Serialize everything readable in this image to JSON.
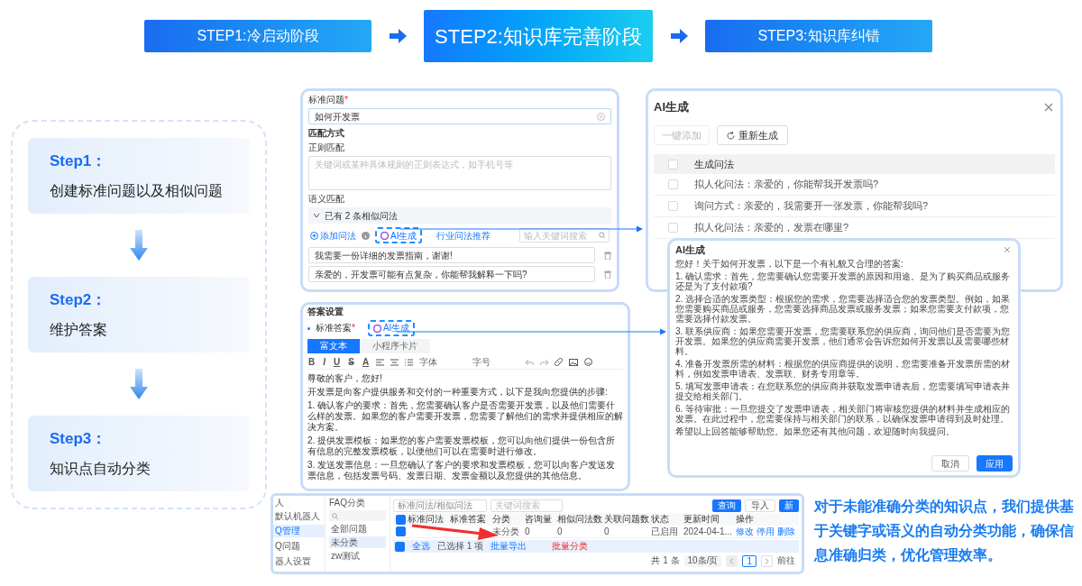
{
  "steps_banner": [
    {
      "label": "STEP1:冷启动阶段",
      "selected": false
    },
    {
      "label": "STEP2:知识库完善阶段",
      "selected": true
    },
    {
      "label": "STEP3:知识库纠错",
      "selected": false
    }
  ],
  "step_cards": [
    {
      "title": "Step1：",
      "text": "创建标准问题以及相似问题"
    },
    {
      "title": "Step2：",
      "text": "维护答案"
    },
    {
      "title": "Step3：",
      "text": "知识点自动分类"
    }
  ],
  "question_form": {
    "title_label": "标准问题",
    "required_mark": "*",
    "question_value": "如何开发票",
    "match_label": "匹配方式",
    "regex_label": "正则匹配",
    "regex_placeholder": "关键词或某种具体规则的正则表达式，如手机号等",
    "semantic_label": "语义匹配",
    "similar_header": "已有 2 条相似问法",
    "expanded": true,
    "add_link": "添加问法",
    "ai_button": "AI生成",
    "recommend_link": "行业问法推荐",
    "search_placeholder": "输入关键词搜索",
    "similar_questions": [
      "我需要一份详细的发票指南，谢谢!",
      "亲爱的，开发票可能有点复杂，你能帮我解释一下吗?"
    ]
  },
  "answer_form": {
    "title": "答案设置",
    "answer_label": "标准答案",
    "required_mark": "*",
    "ai_button": "AI生成",
    "tabs": [
      {
        "label": "富文本",
        "selected": true
      },
      {
        "label": "小程序卡片",
        "selected": false
      }
    ],
    "format_buttons": [
      "B",
      "I",
      "U",
      "S",
      "A"
    ],
    "font_select": "字体",
    "size_select": "字号",
    "paragraphs": [
      "尊敬的客户，您好!",
      "开发票是向客户提供服务和交付的一种重要方式，以下是我向您提供的步骤:",
      "1. 确认客户的要求：首先，您需要确认客户是否需要开发票，以及他们需要什么样的发票。如果您的客户需要开发票，您需要了解他们的需求并提供相应的解决方案。",
      "2. 提供发票模板：如果您的客户需要发票模板，您可以向他们提供一份包含所有信息的完整发票模板，以便他们可以在需要时进行修改。",
      "3. 发送发票信息：一旦您确认了客户的要求和发票模板，您可以向客户发送发票信息，包括发票号码、发票日期、发票金额以及您提供的其他信息。"
    ]
  },
  "ai_questions_dialog": {
    "title": "AI生成",
    "add_button": "一键添加",
    "regenerate_button": "重新生成",
    "column": "生成问法",
    "header_checked": false,
    "rows": [
      {
        "text": "拟人化问法：亲爱的，你能帮我开发票吗?",
        "checked": false
      },
      {
        "text": "询问方式：亲爱的，我需要开一张发票，你能帮我吗?",
        "checked": false
      },
      {
        "text": "拟人化问法：亲爱的，发票在哪里?",
        "checked": false
      }
    ]
  },
  "ai_answer_dialog": {
    "title": "AI生成",
    "paragraphs": [
      "您好！关于如何开发票，以下是一个有礼貌又合理的答案:",
      "1. 确认需求：首先，您需要确认您需要开发票的原因和用途。是为了购买商品或服务还是为了支付款项?",
      "2. 选择合适的发票类型：根据您的需求，您需要选择适合您的发票类型。例如，如果您需要购买商品或服务，您需要选择商品发票或服务发票；如果您需要支付款项，您需要选择付款发票。",
      "3. 联系供应商：如果您需要开发票，您需要联系您的供应商，询问他们是否需要为您开发票。如果您的供应商需要开发票，他们通常会告诉您如何开发票以及需要哪些材料。",
      "4. 准备开发票所需的材料：根据您的供应商提供的说明，您需要准备开发票所需的材料，例如发票申请表、发票联、财务专用章等。",
      "5. 填写发票申请表：在您联系您的供应商并获取发票申请表后，您需要填写申请表并提交给相关部门。",
      "6. 等待审批：一旦您提交了发票申请表，相关部门将审核您提供的材料并生成相应的发票。在此过程中，您需要保持与相关部门的联系，以确保发票申请得到及时处理。",
      "希望以上回答能够帮助您。如果您还有其他问题，欢迎随时向我提问。"
    ],
    "cancel_button": "取消",
    "apply_button": "应用"
  },
  "faq_manager": {
    "robot_label": "人",
    "robot_select": "默认机器人",
    "nav": [
      {
        "label": "Q管理",
        "selected": true
      },
      {
        "label": "Q问题",
        "selected": false
      },
      {
        "label": "器人设置",
        "selected": false
      }
    ],
    "category_title": "FAQ分类",
    "categories": [
      {
        "label": "全部问题",
        "selected": false
      },
      {
        "label": "未分类",
        "selected": true
      },
      {
        "label": "zw测试",
        "selected": false
      }
    ],
    "filter_select": "标准问法/相似问法",
    "search_placeholder": "关键词搜索",
    "buttons": [
      "查询",
      "导入",
      "新"
    ],
    "columns": [
      "标准问法",
      "标准答案",
      "分类",
      "咨询量",
      "相似问法数",
      "关联问题数",
      "状态",
      "更新时间",
      "操作"
    ],
    "rows": [
      {
        "checked": true,
        "cells": [
          "",
          "",
          "未分类",
          "0",
          "0",
          "0",
          "已启用",
          "2024-04-1..."
        ],
        "actions": [
          "修改",
          "停用",
          "删除"
        ]
      }
    ],
    "header_checked": true,
    "batch": {
      "checked": true,
      "select_all": "全选",
      "selected_count": "已选择 1 项",
      "export": "批量导出",
      "classify": "批量分类"
    },
    "pagination": {
      "total": "共 1 条",
      "page_size": "10条/页",
      "page": "1",
      "goto": "前往"
    }
  },
  "caption": "对于未能准确分类的知识点，我们提供基于关键字或语义的自动分类功能，确保信息准确归类，优化管理效率。"
}
